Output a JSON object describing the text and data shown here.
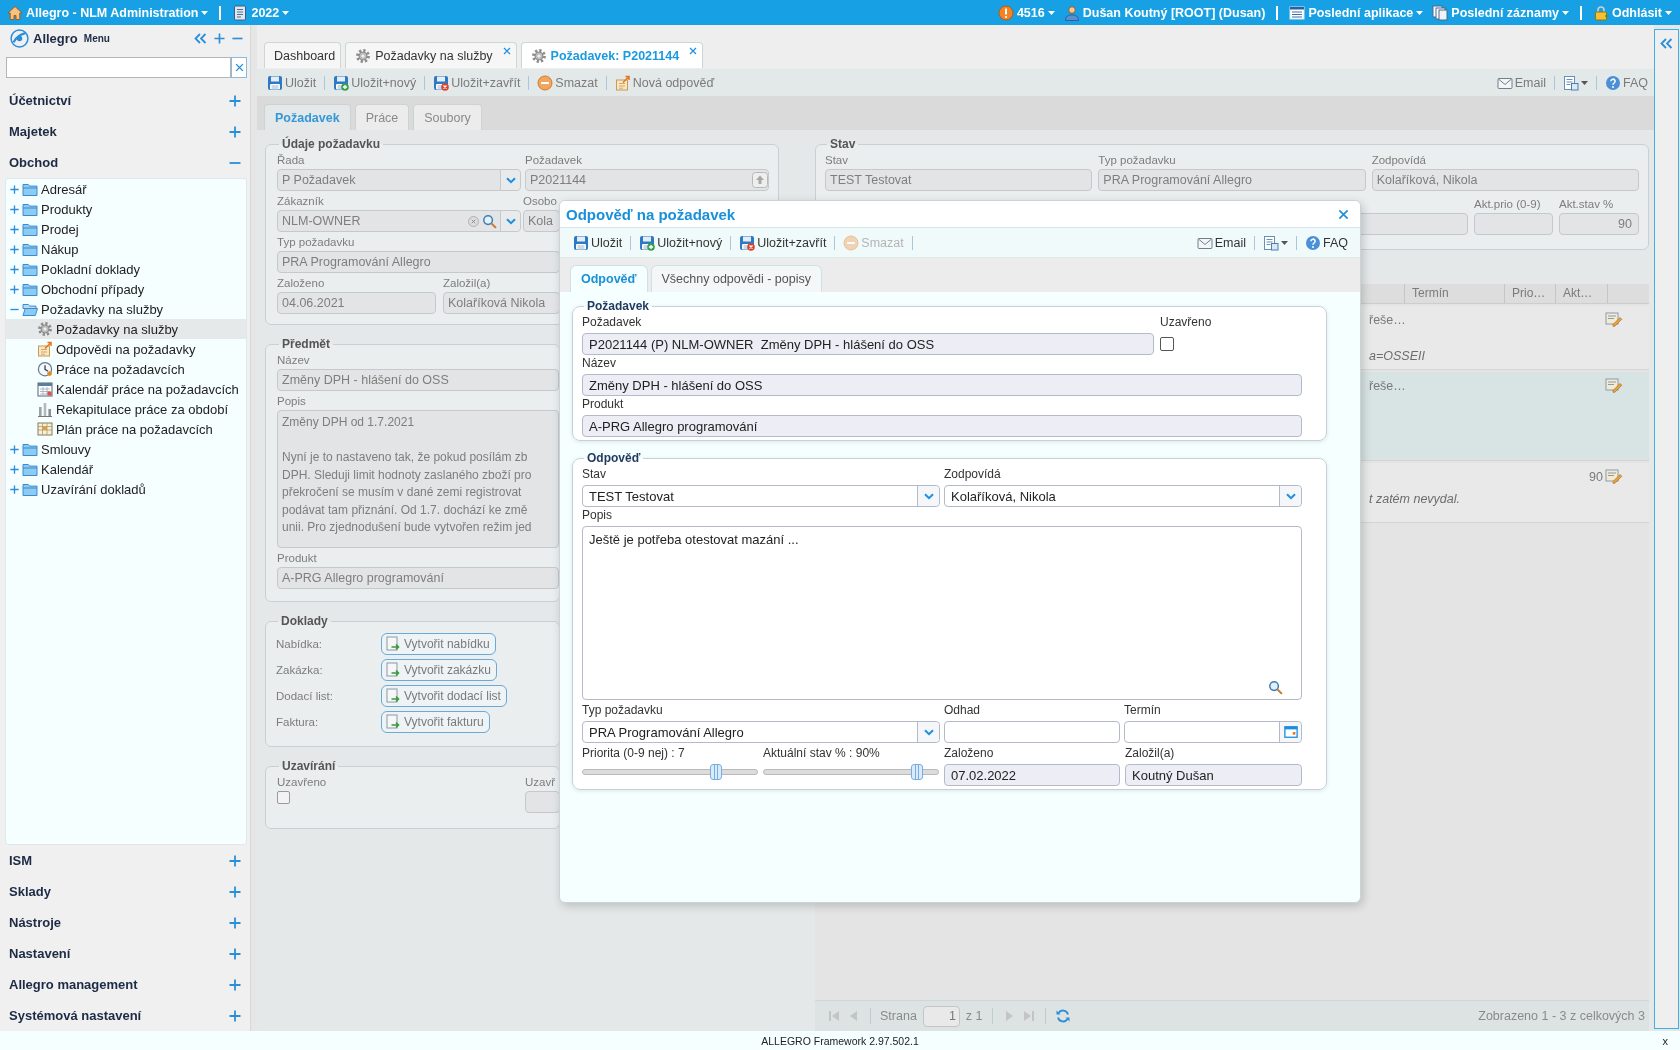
{
  "top_bar": {
    "left": [
      {
        "kind": "home",
        "label": "Allegro - NLM Administration",
        "dropdown": true
      },
      {
        "kind": "year",
        "label": "2022",
        "dropdown": true
      }
    ],
    "right": [
      {
        "kind": "alert",
        "label": "4516",
        "dropdown": true
      },
      {
        "kind": "user",
        "label": "Dušan Koutný [ROOT] (Dusan)",
        "dropdown": false
      },
      {
        "kind": "apps",
        "label": "Poslední aplikace",
        "dropdown": true
      },
      {
        "kind": "records",
        "label": "Poslední záznamy",
        "dropdown": true
      },
      {
        "kind": "logout",
        "label": "Odhlásit",
        "dropdown": true
      }
    ]
  },
  "sidebar": {
    "title": "Allegro",
    "subtitle": "Menu",
    "sections": [
      {
        "label": "Účetnictví",
        "expanded": false
      },
      {
        "label": "Majetek",
        "expanded": false
      },
      {
        "label": "Obchod",
        "expanded": true,
        "tree": [
          {
            "label": "Adresář",
            "kind": "folder",
            "expanded": false,
            "selected": false
          },
          {
            "label": "Produkty",
            "kind": "folder",
            "expanded": false,
            "selected": false
          },
          {
            "label": "Prodej",
            "kind": "folder",
            "expanded": false,
            "selected": false
          },
          {
            "label": "Nákup",
            "kind": "folder",
            "expanded": false,
            "selected": false
          },
          {
            "label": "Pokladní doklady",
            "kind": "folder",
            "expanded": false,
            "selected": false
          },
          {
            "label": "Obchodní případy",
            "kind": "folder",
            "expanded": false,
            "selected": false
          },
          {
            "label": "Požadavky na služby",
            "kind": "folder",
            "expanded": true,
            "selected": false,
            "children": [
              {
                "label": "Požadavky na služby",
                "kind": "requests",
                "selected": true
              },
              {
                "label": "Odpovědi na požadavky",
                "kind": "responses",
                "selected": false
              },
              {
                "label": "Práce na požadavcích",
                "kind": "work",
                "selected": false
              },
              {
                "label": "Kalendář práce na požadavcích",
                "kind": "work-calendar",
                "selected": false
              },
              {
                "label": "Rekapitulace práce za období",
                "kind": "work-summary",
                "selected": false
              },
              {
                "label": "Plán práce na požadavcích",
                "kind": "work-plan",
                "selected": false
              }
            ]
          },
          {
            "label": "Smlouvy",
            "kind": "folder",
            "expanded": false,
            "selected": false
          },
          {
            "label": "Kalendář",
            "kind": "folder",
            "expanded": false,
            "selected": false
          },
          {
            "label": "Uzavírání dokladů",
            "kind": "folder",
            "expanded": false,
            "selected": false
          }
        ]
      },
      {
        "label": "ISM",
        "expanded": false
      },
      {
        "label": "Sklady",
        "expanded": false
      },
      {
        "label": "Nástroje",
        "expanded": false
      },
      {
        "label": "Nastavení",
        "expanded": false
      },
      {
        "label": "Allegro management",
        "expanded": false
      },
      {
        "label": "Systémová nastavení",
        "expanded": false
      }
    ]
  },
  "document_tabs": [
    {
      "label": "Dashboard",
      "kind": "dashboard",
      "selected": false,
      "closable": false
    },
    {
      "label": "Požadavky na služby",
      "kind": "list",
      "selected": false,
      "closable": true
    },
    {
      "label": "Požadavek: P2021144",
      "kind": "record",
      "selected": true,
      "closable": true
    }
  ],
  "toolbar": {
    "left": [
      {
        "label": "Uložit",
        "kind": "save"
      },
      {
        "label": "Uložit+nový",
        "kind": "save-new"
      },
      {
        "label": "Uložit+zavřít",
        "kind": "save-close"
      },
      {
        "label": "Smazat",
        "kind": "delete"
      },
      {
        "label": "Nová odpověď",
        "kind": "new-reply"
      }
    ],
    "right": [
      {
        "label": "Email",
        "kind": "email"
      },
      {
        "kind": "report",
        "dropdown": true
      },
      {
        "label": "FAQ",
        "kind": "faq"
      }
    ]
  },
  "form_tabs": [
    {
      "label": "Požadavek",
      "selected": true
    },
    {
      "label": "Práce",
      "selected": false
    },
    {
      "label": "Soubory",
      "selected": false
    }
  ],
  "request_details": {
    "legend": "Údaje požadavku",
    "rows": [
      [
        {
          "label": "Řada",
          "value": "P Požadavek",
          "kind": "select"
        },
        {
          "label": "Požadavek",
          "value": "P2021144",
          "kind": "code"
        }
      ],
      [
        {
          "label": "Zákazník",
          "value": "NLM-OWNER",
          "kind": "lookup"
        },
        {
          "label": "Osobo",
          "value": "Kola",
          "kind": "text"
        }
      ],
      [
        {
          "label": "Typ požadavku",
          "value": "PRA Programování Allegro",
          "kind": "text"
        }
      ],
      [
        {
          "label": "Založeno",
          "value": "04.06.2021",
          "kind": "text"
        },
        {
          "label": "Založil(a)",
          "value": "Kolaříková Nikola",
          "kind": "text"
        }
      ]
    ]
  },
  "subject": {
    "legend": "Předmět",
    "name": {
      "label": "Název",
      "value": "Změny DPH - hlášení do OSS"
    },
    "description": {
      "label": "Popis",
      "value": "Změny DPH od 1.7.2021\n\nNyní je to nastaveno tak, že pokud posílám zb\nDPH. Sleduji limit hodnoty zaslaného zboží pro\npřekročení se musím v dané zemi registrovat\npodávat tam přiznání. Od 1.7. dochází ke změ\nunii. Pro zjednodušení bude vytvořen režim jed"
    },
    "product": {
      "label": "Produkt",
      "value": "A-PRG Allegro programování"
    }
  },
  "documents": {
    "legend": "Doklady",
    "rows": [
      {
        "label": "Nabídka:",
        "button": "Vytvořit nabídku"
      },
      {
        "label": "Zakázka:",
        "button": "Vytvořit zakázku"
      },
      {
        "label": "Dodací list:",
        "button": "Vytvořit dodací list"
      },
      {
        "label": "Faktura:",
        "button": "Vytvořit fakturu"
      }
    ]
  },
  "closing": {
    "legend": "Uzavírání",
    "closed_label": "Uzavřeno",
    "closed": false,
    "field_label": "Uzavř"
  },
  "status": {
    "legend": "Stav",
    "fields": [
      {
        "label": "Stav",
        "value": "TEST Testovat"
      },
      {
        "label": "Typ požadavku",
        "value": "PRA Programování Allegro"
      },
      {
        "label": "Zodpovídá",
        "value": "Kolaříková, Nikola"
      }
    ],
    "priority_label": "Akt.prio (0-9)",
    "progress_label": "Akt.stav %",
    "progress_value": "90"
  },
  "grid": {
    "columns": [
      "Termín",
      "Prio…",
      "Akt…"
    ],
    "rows": [
      {
        "column_1": "řeše…",
        "note": "a=OSSEII",
        "selected": false
      },
      {
        "column_1": "řeše…",
        "selected": true
      },
      {
        "akt": "90",
        "note": "t zatém nevydal.",
        "selected": false
      }
    ]
  },
  "pagination": {
    "buttons": [
      {
        "kind": "first",
        "disabled": true
      },
      {
        "kind": "prev",
        "disabled": true
      },
      {
        "kind": "next",
        "disabled": true
      },
      {
        "kind": "last",
        "disabled": true
      },
      {
        "kind": "refresh",
        "disabled": false
      }
    ],
    "page_label": "Strana",
    "page": "1",
    "page_count": "z 1",
    "summary": "Zobrazeno 1 - 3 z celkových 3"
  },
  "dialog": {
    "title": "Odpověď na požadavek",
    "toolbar": {
      "left": [
        {
          "label": "Uložit",
          "kind": "save",
          "disabled": false
        },
        {
          "label": "Uložit+nový",
          "kind": "save-new",
          "disabled": false
        },
        {
          "label": "Uložit+zavřít",
          "kind": "save-close",
          "disabled": false
        },
        {
          "label": "Smazat",
          "kind": "delete",
          "disabled": true
        }
      ],
      "right": [
        {
          "label": "Email",
          "kind": "email"
        },
        {
          "kind": "report",
          "dropdown": true
        },
        {
          "label": "FAQ",
          "kind": "faq"
        }
      ]
    },
    "tabs": [
      {
        "label": "Odpověď",
        "selected": true
      },
      {
        "label": "Všechny odpovědi - popisy",
        "selected": false
      }
    ],
    "request": {
      "legend": "Požadavek",
      "request": {
        "label": "Požadavek",
        "value": "P2021144 (P) NLM-OWNER  Změny DPH - hlášení do OSS",
        "readonly": true
      },
      "closed": {
        "label": "Uzavřeno",
        "checked": false
      },
      "name": {
        "label": "Název",
        "value": "Změny DPH - hlášení do OSS",
        "readonly": true
      },
      "product": {
        "label": "Produkt",
        "value": "A-PRG Allegro programování",
        "readonly": true
      }
    },
    "response": {
      "legend": "Odpověď",
      "status": {
        "label": "Stav",
        "value": "TEST Testovat",
        "readonly": false
      },
      "assignee": {
        "label": "Zodpovídá",
        "value": "Kolaříková, Nikola",
        "readonly": false
      },
      "description": {
        "label": "Popis",
        "value": "Ještě je potřeba otestovat mazání ..."
      },
      "type": {
        "label": "Typ požadavku",
        "value": "PRA Programování Allegro",
        "readonly": false
      },
      "estimate": {
        "label": "Odhad",
        "readonly": false
      },
      "deadline": {
        "label": "Termín",
        "readonly": false
      },
      "priority": {
        "label": "Priorita (0-9 nej) : 7",
        "level": 0.78
      },
      "progress": {
        "label": "Aktuální stav % : 90%",
        "level": 0.9
      },
      "created": {
        "label": "Založeno",
        "value": "07.02.2022",
        "readonly": true
      },
      "created_by": {
        "label": "Založil(a)",
        "value": "Koutný Dušan",
        "readonly": true
      }
    }
  },
  "footer": {
    "version": "ALLEGRO Framework 2.97.502.1",
    "close": "x"
  }
}
